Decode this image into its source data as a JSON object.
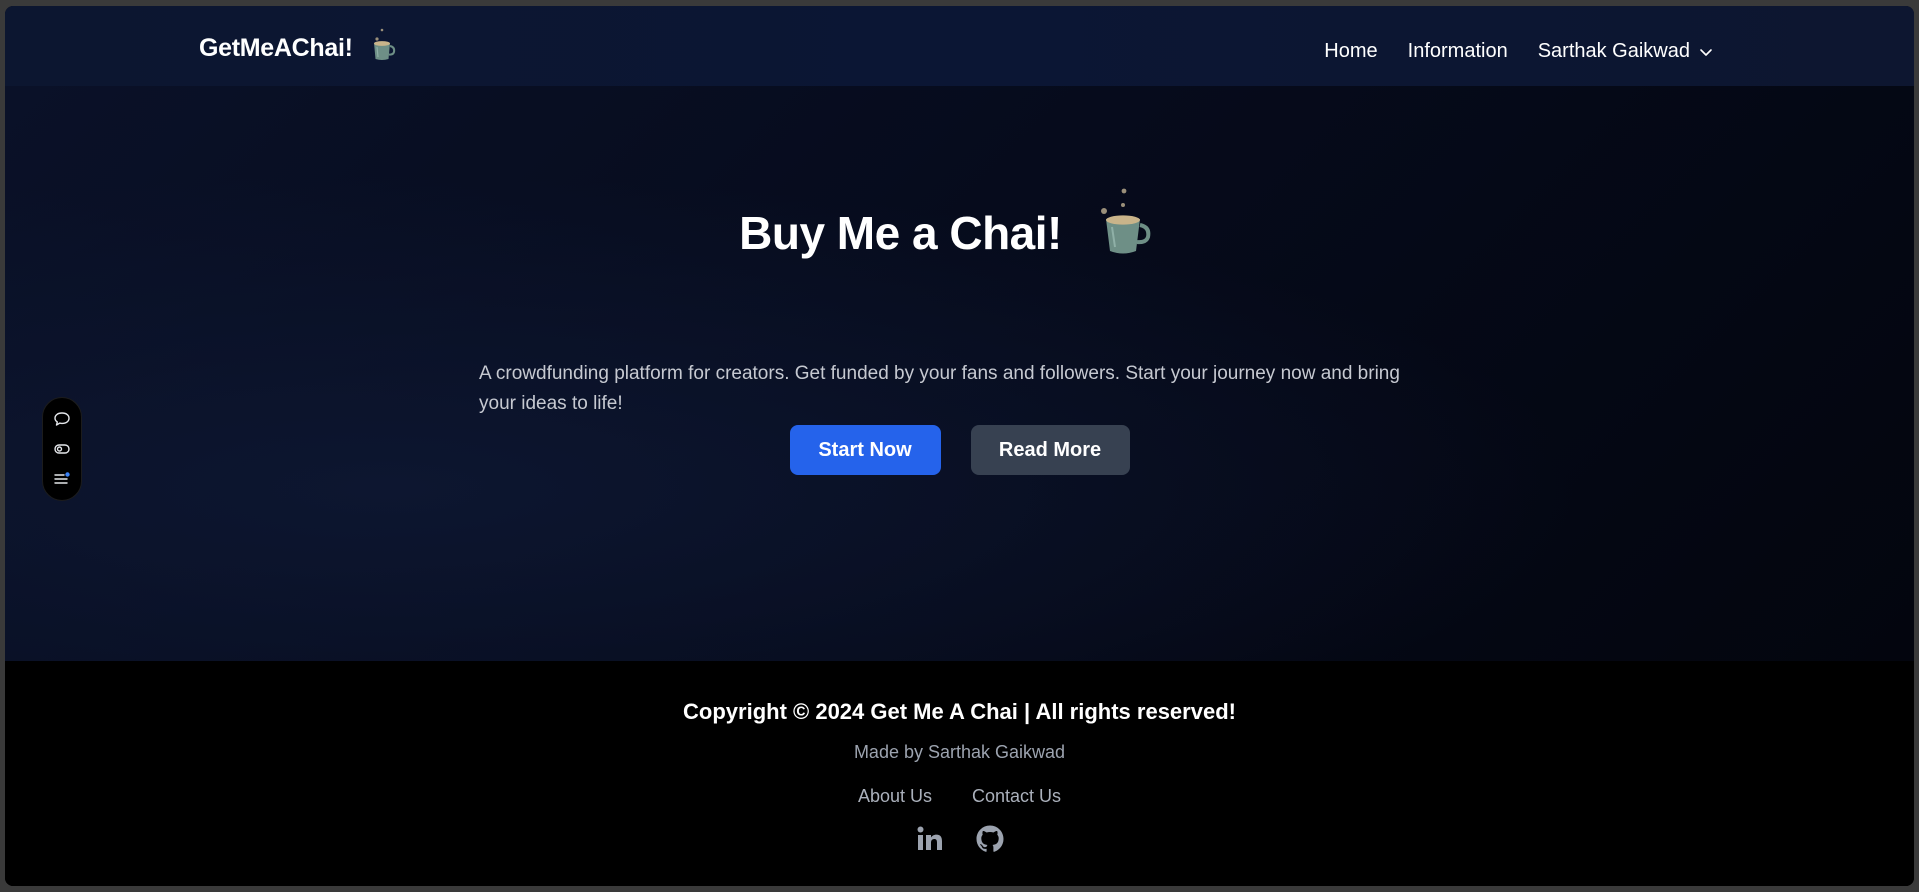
{
  "navbar": {
    "brand": "GetMeAChai!",
    "links": [
      "Home",
      "Information"
    ],
    "user_name": "Sarthak Gaikwad",
    "icons": {
      "brand": "chai-cup-icon",
      "user_menu": "chevron-down-icon"
    }
  },
  "hero": {
    "title": "Buy Me a Chai!",
    "description": "A crowdfunding platform for creators. Get funded by your fans and followers. Start your journey now and bring your ideas to life!",
    "primary_button": "Start Now",
    "secondary_button": "Read More"
  },
  "floating_toolbar": {
    "icons": [
      "chat-bubble-icon",
      "toggle-icon",
      "list-icon"
    ]
  },
  "footer": {
    "copyright": "Copyright © 2024 Get Me A Chai | All rights reserved!",
    "made_by": "Made by Sarthak Gaikwad",
    "links": [
      "About Us",
      "Contact Us"
    ],
    "social_icons": [
      "linkedin-icon",
      "github-icon"
    ]
  },
  "colors": {
    "accent": "#2563eb",
    "secondary_button": "#374151",
    "navbar_bg": "#0b1634",
    "footer_bg": "#000000"
  }
}
